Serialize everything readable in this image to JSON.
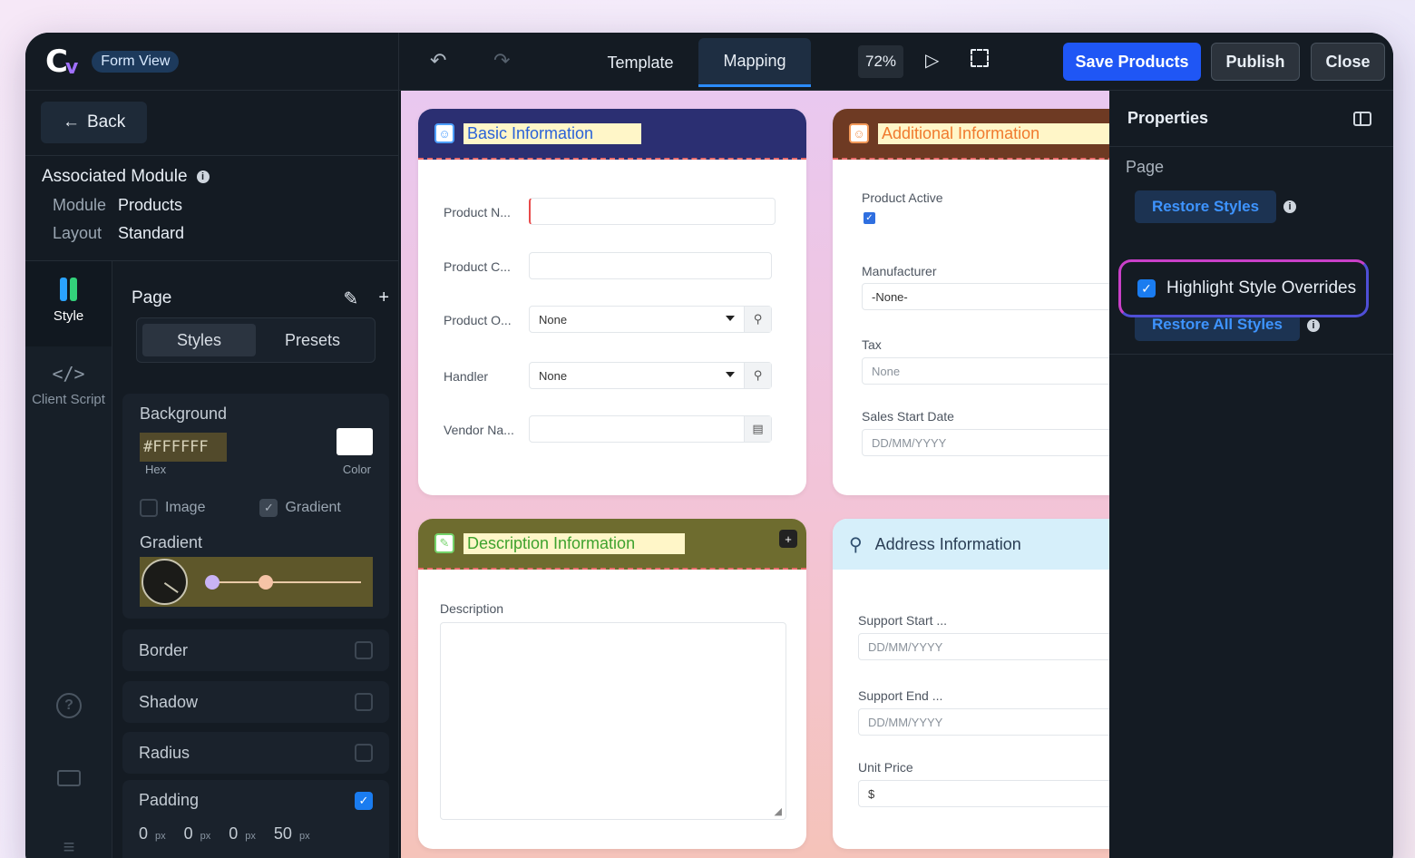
{
  "brand": {
    "logo": "C",
    "mode_pill": "Form View"
  },
  "left": {
    "back_label": "Back",
    "assoc_title": "Associated Module",
    "module_key": "Module",
    "module_val": "Products",
    "layout_key": "Layout",
    "layout_val": "Standard",
    "rail": {
      "style": "Style",
      "client_script": "Client Script"
    },
    "page_label": "Page",
    "seg": {
      "styles": "Styles",
      "presets": "Presets"
    },
    "background": {
      "title": "Background",
      "hex": "#FFFFFF",
      "hex_label": "Hex",
      "color_label": "Color",
      "image_label": "Image",
      "gradient_check_label": "Gradient",
      "gradient_title": "Gradient",
      "swatch_color": "#ffffff",
      "gradient_color": "#5e572a"
    },
    "border": "Border",
    "shadow": "Shadow",
    "radius": "Radius",
    "padding": {
      "title": "Padding",
      "v1": "0",
      "v2": "0",
      "v3": "0",
      "v4": "50",
      "unit": "px"
    }
  },
  "topbar": {
    "tab_template": "Template",
    "tab_mapping": "Mapping",
    "zoom": "72%",
    "save": "Save Products",
    "publish": "Publish",
    "close": "Close",
    "accent": "#1f56f5"
  },
  "canvas": {
    "basic": {
      "title": "Basic Information",
      "f1": "Product N...",
      "f2": "Product C...",
      "f3": "Product O...",
      "f3_val": "None",
      "f4": "Handler",
      "f4_val": "None",
      "f5": "Vendor Na..."
    },
    "additional": {
      "title": "Additional Information",
      "f1": "Product Active",
      "f2": "Manufacturer",
      "f2_val": "-None-",
      "f3": "Tax",
      "f3_val": "None",
      "f4": "Sales Start Date",
      "f4_ph": "DD/MM/YYYY"
    },
    "description": {
      "title": "Description Information",
      "f1": "Description"
    },
    "address": {
      "title": "Address Information",
      "f1": "Support Start ...",
      "f1_ph": "DD/MM/YYYY",
      "f2": "Support End ...",
      "f2_ph": "DD/MM/YYYY",
      "f3": "Unit Price",
      "f3_val": "$"
    }
  },
  "props": {
    "title": "Properties",
    "page": "Page",
    "restore": "Restore Styles",
    "highlight": "Highlight Style Overrides",
    "restore_all": "Restore All Styles"
  }
}
